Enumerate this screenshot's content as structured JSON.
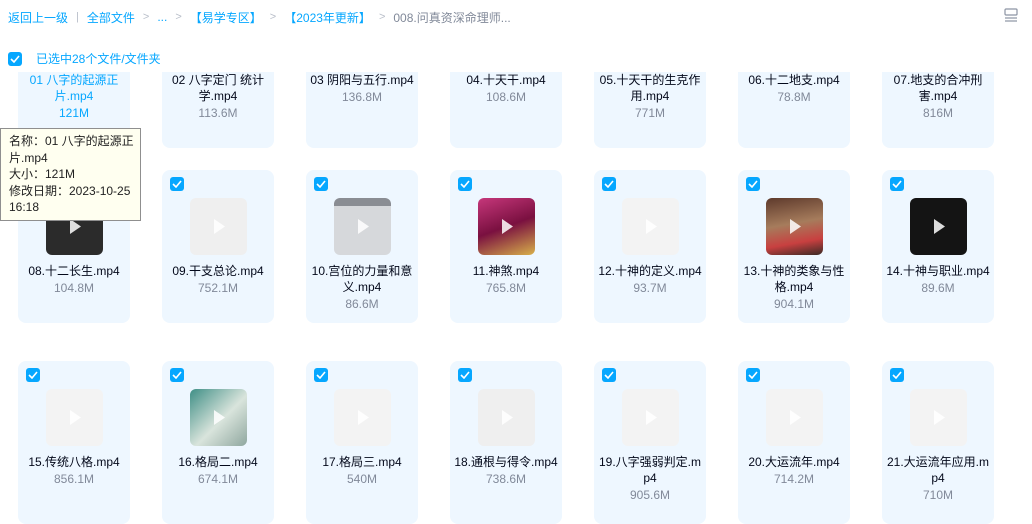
{
  "breadcrumb": {
    "back": "返回上一级",
    "all_files": "全部文件",
    "ellipsis": "...",
    "folder1": "【易学专区】",
    "folder2": "【2023年更新】",
    "current": "008.问真资深命理师..."
  },
  "selection": {
    "text": "已选中28个文件/文件夹"
  },
  "tooltip": {
    "name_line": "名称：01 八字的起源正片.mp4",
    "size_line": "大小：121M",
    "date_line": "修改日期：2023-10-25 16:18"
  },
  "colors": {
    "accent": "#06a7ff",
    "card_bg": "#eef7ff",
    "size_text": "#818999"
  },
  "files": [
    {
      "name": "01 八字的起源正片.mp4",
      "size": "121M",
      "thumb": "video-icon"
    },
    {
      "name": "02 八字定门 统计学.mp4",
      "size": "113.6M",
      "thumb": "video-icon"
    },
    {
      "name": "03 阴阳与五行.mp4",
      "size": "136.8M",
      "thumb": "video-icon"
    },
    {
      "name": "04.十天干.mp4",
      "size": "108.6M",
      "thumb": "video-icon"
    },
    {
      "name": "05.十天干的生克作用.mp4",
      "size": "771M",
      "thumb": "video-icon"
    },
    {
      "name": "06.十二地支.mp4",
      "size": "78.8M",
      "thumb": "video-icon"
    },
    {
      "name": "07.地支的合冲刑害.mp4",
      "size": "816M",
      "thumb": "video-icon"
    },
    {
      "name": "08.十二长生.mp4",
      "size": "104.8M",
      "thumb": "video-thumbnail"
    },
    {
      "name": "09.干支总论.mp4",
      "size": "752.1M",
      "thumb": "video-thumbnail"
    },
    {
      "name": "10.宫位的力量和意义.mp4",
      "size": "86.6M",
      "thumb": "video-thumbnail"
    },
    {
      "name": "11.神煞.mp4",
      "size": "765.8M",
      "thumb": "video-thumbnail"
    },
    {
      "name": "12.十神的定义.mp4",
      "size": "93.7M",
      "thumb": "video-thumbnail"
    },
    {
      "name": "13.十神的类象与性格.mp4",
      "size": "904.1M",
      "thumb": "video-thumbnail"
    },
    {
      "name": "14.十神与职业.mp4",
      "size": "89.6M",
      "thumb": "video-thumbnail"
    },
    {
      "name": "15.传统八格.mp4",
      "size": "856.1M",
      "thumb": "video-thumbnail"
    },
    {
      "name": "16.格局二.mp4",
      "size": "674.1M",
      "thumb": "video-thumbnail"
    },
    {
      "name": "17.格局三.mp4",
      "size": "540M",
      "thumb": "video-thumbnail"
    },
    {
      "name": "18.通根与得令.mp4",
      "size": "738.6M",
      "thumb": "video-thumbnail"
    },
    {
      "name": "19.八字强弱判定.mp4",
      "size": "905.6M",
      "thumb": "video-thumbnail"
    },
    {
      "name": "20.大运流年.mp4",
      "size": "714.2M",
      "thumb": "video-thumbnail"
    },
    {
      "name": "21.大运流年应用.mp4",
      "size": "710M",
      "thumb": "video-thumbnail"
    }
  ]
}
